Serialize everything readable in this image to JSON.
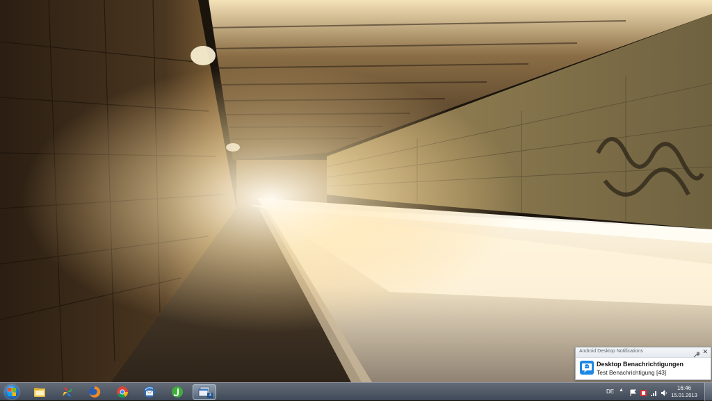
{
  "wallpaper": {
    "description_icon": "tunnel-wallpaper"
  },
  "notification": {
    "app_name": "Android Desktop Notifications",
    "title": "Desktop Benachrichtigungen",
    "body": "Test Benachrichtigung [43]",
    "close_glyph": "✕",
    "accent_color": "#1e88e5"
  },
  "taskbar": {
    "pinned": [
      {
        "name": "explorer",
        "icon": "folder-icon"
      },
      {
        "name": "colorful-app",
        "icon": "pinwheel-icon"
      },
      {
        "name": "firefox",
        "icon": "firefox-icon"
      },
      {
        "name": "chrome",
        "icon": "chrome-icon"
      },
      {
        "name": "thunderbird",
        "icon": "thunderbird-icon"
      },
      {
        "name": "jdownloader",
        "icon": "jdownloader-icon"
      },
      {
        "name": "app-group",
        "icon": "window-stack-icon",
        "badge": "3"
      }
    ],
    "tray": {
      "language": "DE",
      "arrow": "▲",
      "time": "16:46",
      "date": "15.01.2013"
    }
  }
}
